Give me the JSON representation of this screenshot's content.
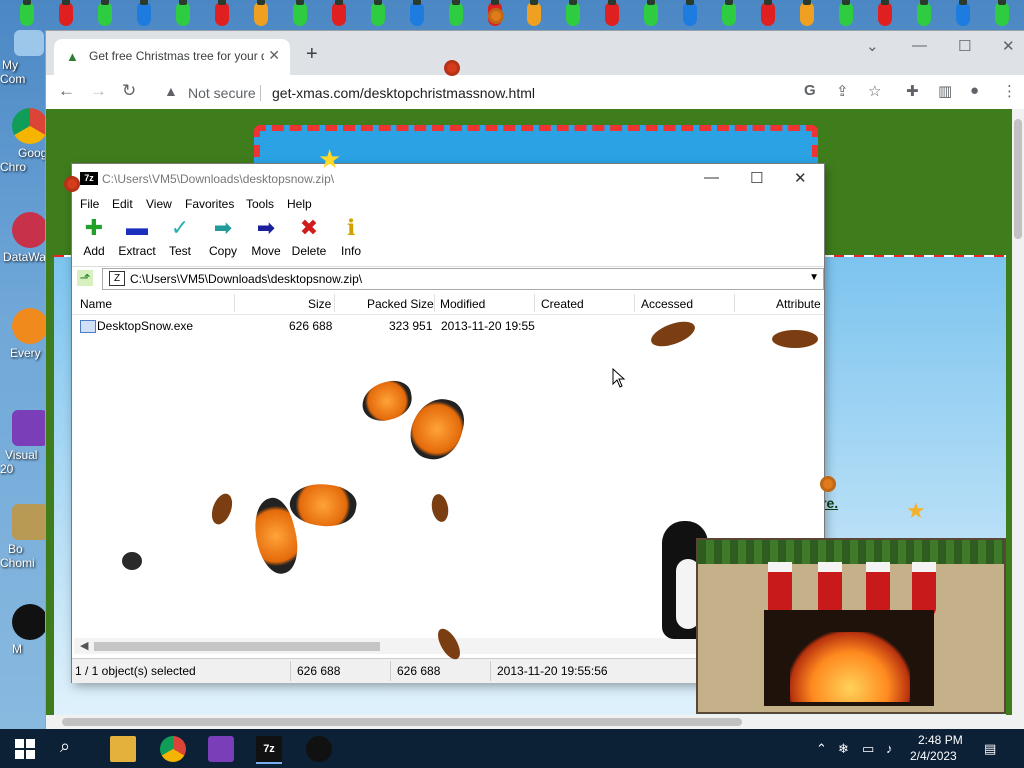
{
  "desktop": {
    "icons": [
      {
        "label": "My Com",
        "icon": "computer-icon"
      },
      {
        "label": "Goog\nChro",
        "icon": "chrome-icon"
      },
      {
        "label": "DataWa",
        "icon": "datawatch-icon"
      },
      {
        "label": "Every",
        "icon": "everything-icon"
      },
      {
        "label": "Visual\n20",
        "icon": "visual-studio-icon"
      },
      {
        "label": "Bo\nChomi",
        "icon": "dog-icon"
      },
      {
        "label": "M",
        "icon": "penguin-icon"
      }
    ]
  },
  "browser": {
    "tab_title": "Get free Christmas tree for your desktop",
    "url_warning": "Not secure",
    "url": "get-xmas.com/desktopchristmassnow.html",
    "page_link": "re."
  },
  "sevenzip": {
    "title": "C:\\Users\\VM5\\Downloads\\desktopsnow.zip\\",
    "menu": [
      "File",
      "Edit",
      "View",
      "Favorites",
      "Tools",
      "Help"
    ],
    "tools": [
      {
        "label": "Add",
        "icon": "plus-icon",
        "color": "#1fa12a"
      },
      {
        "label": "Extract",
        "icon": "minus-icon",
        "color": "#1b2fbf"
      },
      {
        "label": "Test",
        "icon": "check-icon",
        "color": "#2ab0b0"
      },
      {
        "label": "Copy",
        "icon": "arrow-right-icon",
        "color": "#239a9a"
      },
      {
        "label": "Move",
        "icon": "arrow-right-icon",
        "color": "#1b1f99"
      },
      {
        "label": "Delete",
        "icon": "x-icon",
        "color": "#d01c1c"
      },
      {
        "label": "Info",
        "icon": "info-icon",
        "color": "#d0a000"
      }
    ],
    "address": "C:\\Users\\VM5\\Downloads\\desktopsnow.zip\\",
    "columns": [
      "Name",
      "Size",
      "Packed Size",
      "Modified",
      "Created",
      "Accessed",
      "Attribute"
    ],
    "rows": [
      {
        "name": "DesktopSnow.exe",
        "size": "626 688",
        "packed": "323 951",
        "modified": "2013-11-20 19:55",
        "created": "",
        "accessed": "",
        "attributes": ""
      }
    ],
    "status": {
      "selection": "1 / 1 object(s) selected",
      "size": "626 688",
      "packed": "626 688",
      "modified": "2013-11-20 19:55:56"
    }
  },
  "taskbar": {
    "time": "2:48 PM",
    "date": "2/4/2023"
  }
}
